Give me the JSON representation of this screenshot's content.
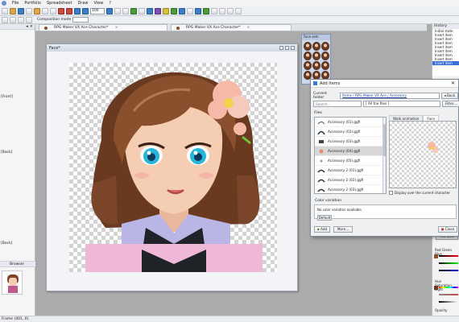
{
  "menubar": {
    "items": [
      "File",
      "Portfolio",
      "Spreadsheet",
      "Draw",
      "View",
      "?"
    ]
  },
  "toolbar": {
    "zoom_value": "100"
  },
  "toolbar2": {
    "composition_mode_label": "Composition mode"
  },
  "tabs": [
    {
      "label": "RPG Maker VX Ace Character*"
    },
    {
      "label": "RPG Maker VX Ace Character*"
    }
  ],
  "left_panel": {
    "labels": [
      "[Front]",
      "[Back]",
      "[Back]"
    ],
    "browser_label": "Browser"
  },
  "canvas_window": {
    "title": "Face*"
  },
  "palette_window": {
    "title": "Face sets"
  },
  "history": {
    "title": "History",
    "items": [
      "Initial state",
      "Insert item",
      "Insert item",
      "Insert item",
      "Insert item",
      "Insert item",
      "Insert item",
      "Insert item",
      "Insert item"
    ],
    "selected_index": 8
  },
  "right_panel": {
    "add_color_label": "Add color",
    "rgb_label": "Red Green Blue",
    "hsl_label": "Hue Saturation Light",
    "opacity_label": "Opacity"
  },
  "dialog": {
    "title": "Add Items",
    "close_glyph": "✕",
    "current_folder_label": "Current folder:",
    "current_folder_value": "Items / RPG Maker VX Ace / Accessory",
    "back_label": "Back",
    "search_placeholder": "Search...",
    "filter_value": "[ All the files ]",
    "filter_button_label": "Filter...",
    "files_header": "Files",
    "files": [
      "Accessory (01).ggfi",
      "Accessory (02).ggfi",
      "Accessory (03).ggfi",
      "Accessory (04).ggfi",
      "Accessory (05).ggfi",
      "Accessory 2 (01).ggfi",
      "Accessory 2 (02).ggfi",
      "Accessory 2 (03).ggfi"
    ],
    "selected_file_index": 3,
    "preview_tabs": [
      "Walk animation",
      "Face"
    ],
    "active_preview_tab": 1,
    "display_over_label": "Display over the current character",
    "color_variation_header": "Color variation",
    "color_variation_text": "No color variation available",
    "default_button_label": "Default",
    "add_button_label": "Add",
    "more_button_label": "More...",
    "close_button_label": "Close"
  },
  "statusbar": {
    "text": "Frame (401, 0)"
  },
  "colors": {
    "accent": "#3b6fd8",
    "hair": "#7a4528",
    "skin": "#f4cdb3",
    "eye": "#27b6d9",
    "collar": "#b9b6e6",
    "shirt": "#f0b8d8"
  }
}
